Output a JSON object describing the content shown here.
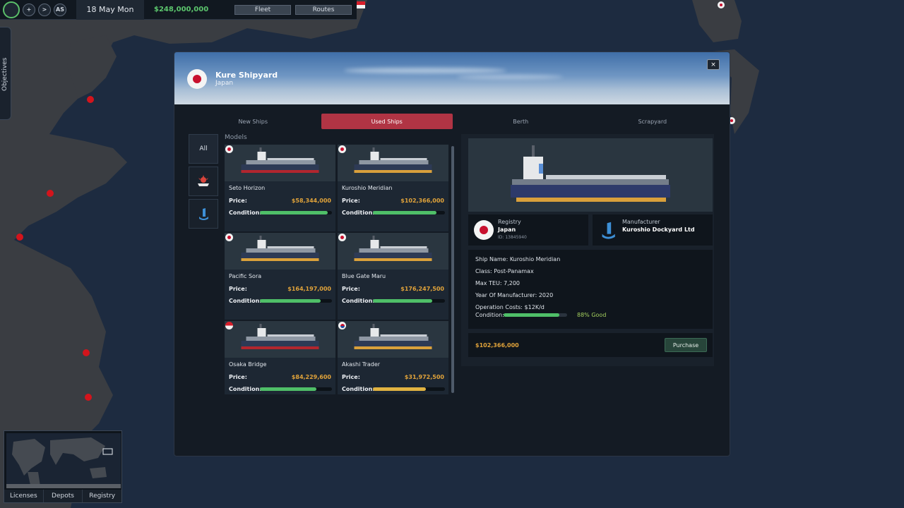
{
  "topbar": {
    "icon_labels": [
      "",
      "+",
      ">",
      "AS"
    ],
    "date": "18 May Mon",
    "money": "$248,000,000",
    "fleet_label": "Fleet",
    "routes_label": "Routes"
  },
  "objectives_label": "Objectives",
  "minimap": {
    "tabs": [
      "Licenses",
      "Depots",
      "Registry"
    ]
  },
  "shipyard": {
    "name": "Kure Shipyard",
    "country": "Japan",
    "close_glyph": "×",
    "tabs": [
      "New Ships",
      "Used Ships",
      "Berth",
      "Scrapyard"
    ],
    "active_tab": "Used Ships",
    "categories": [
      "All"
    ],
    "models_label": "Models",
    "price_label": "Price:",
    "condition_label": "Condition:",
    "ships": [
      {
        "name": "Seto Horizon",
        "price": "$58,344,000",
        "condition": 0.94,
        "flag": "jp"
      },
      {
        "name": "Kuroshio Meridian",
        "price": "$102,366,000",
        "condition": 0.88,
        "flag": "jp"
      },
      {
        "name": "Pacific Sora",
        "price": "$164,197,000",
        "condition": 0.84,
        "flag": "jp"
      },
      {
        "name": "Blue Gate Maru",
        "price": "$176,247,500",
        "condition": 0.82,
        "flag": "jp"
      },
      {
        "name": "Osaka Bridge",
        "price": "$84,229,600",
        "condition": 0.78,
        "flag": "sg"
      },
      {
        "name": "Akashi Trader",
        "price": "$31,972,500",
        "condition": 0.74,
        "flag": "kr"
      }
    ]
  },
  "detail": {
    "registry_label": "Registry",
    "registry_value": "Japan",
    "registry_id": "ID: 13845940",
    "manufacturer_label": "Manufacturer",
    "manufacturer_value": "Kuroshio Dockyard Ltd",
    "ship_name": "Ship Name: Kuroshio Meridian",
    "class": "Class: Post-Panamax",
    "max_teu": "Max TEU: 7,200",
    "year": "Year Of Manufacturer: 2020",
    "operation_costs": "Operation Costs: $12K/d",
    "condition_label": "Condition:",
    "condition_value": 0.88,
    "condition_text": "88% Good",
    "price": "$102,366,000",
    "purchase_label": "Purchase"
  },
  "colors": {
    "accent_red": "#b03444",
    "price_gold": "#e1a33a",
    "condition_green": "#4fbf68",
    "condition_yellow": "#e1b341",
    "money_green": "#5cc66d"
  }
}
